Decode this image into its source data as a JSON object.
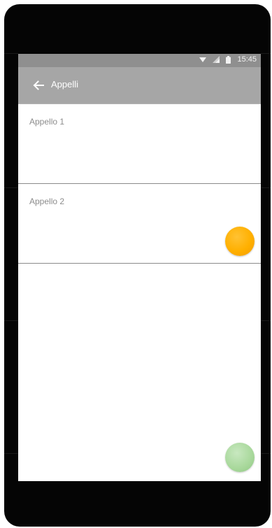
{
  "status_bar": {
    "time": "15:45",
    "icons": [
      "wifi-icon",
      "signal-icon",
      "battery-icon"
    ]
  },
  "app_bar": {
    "back_icon": "arrow-left-icon",
    "title": "Appelli"
  },
  "list": {
    "items": [
      {
        "label": "Appello 1"
      },
      {
        "label": "Appello 2"
      }
    ]
  },
  "colors": {
    "status_bar": "#8f8f8f",
    "app_bar": "#a6a6a6",
    "orange_dot": "#ffb000",
    "green_dot": "#a8d89b"
  }
}
